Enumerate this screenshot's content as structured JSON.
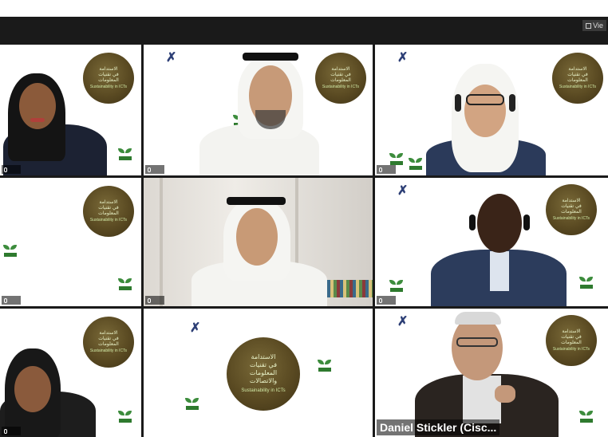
{
  "window": {
    "view_label": "Vie"
  },
  "badge": {
    "arabic_lines": [
      "الاستدامة",
      "في تقنيات",
      "المعلومات",
      "والاتصالات"
    ],
    "english": "Sustainability in ICTs"
  },
  "participants": [
    {
      "id": "p1",
      "name": ""
    },
    {
      "id": "p2",
      "name": ""
    },
    {
      "id": "p3",
      "name": ""
    },
    {
      "id": "p4",
      "name": ""
    },
    {
      "id": "p5",
      "name": ""
    },
    {
      "id": "p6",
      "name": ""
    },
    {
      "id": "p7",
      "name": ""
    },
    {
      "id": "p8",
      "name": ""
    },
    {
      "id": "p9",
      "name": "Daniel Stickler (Cisc..."
    }
  ],
  "colors": {
    "grid_bg": "#1a1a1a",
    "badge_brown": "#5a4a22",
    "leaf_green": "#3c8c3c",
    "logo_blue": "#2d3f76"
  }
}
